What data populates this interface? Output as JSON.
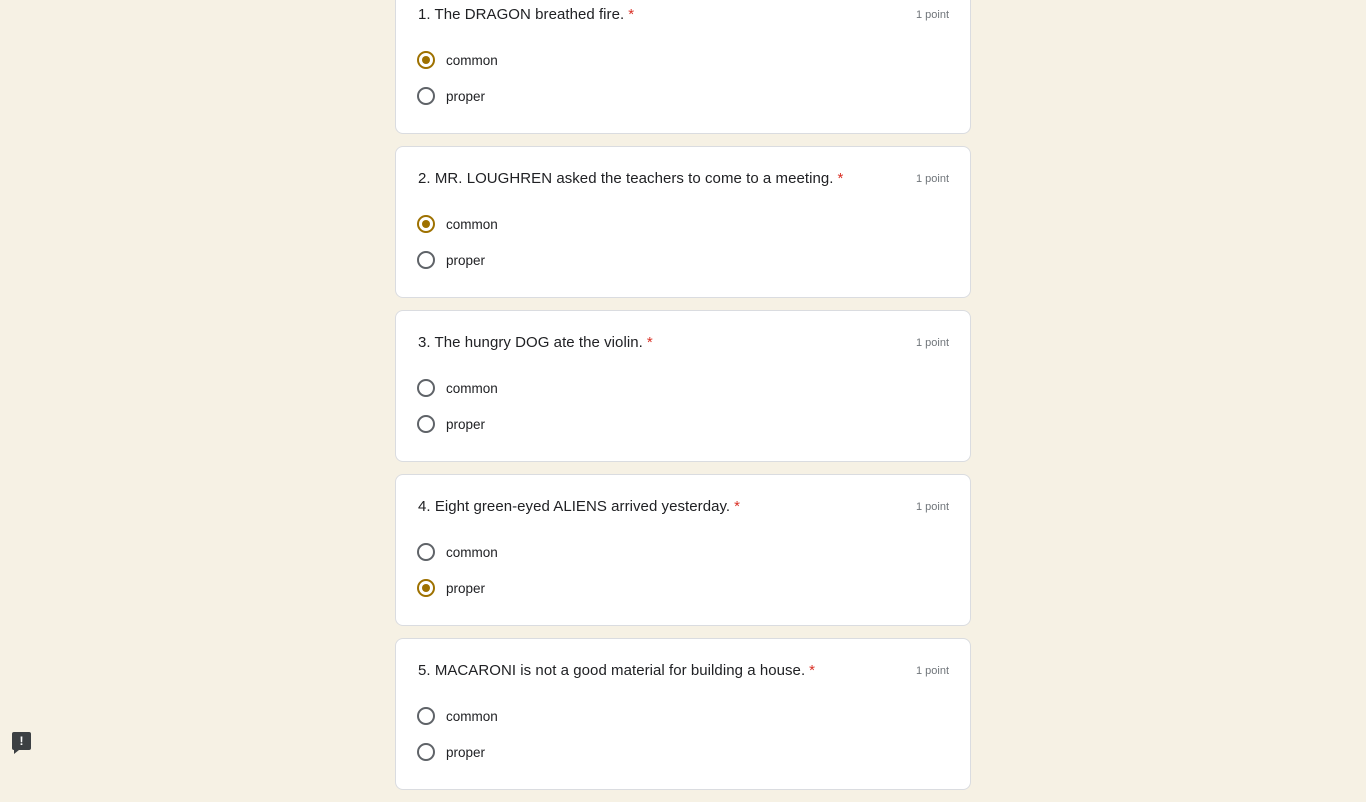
{
  "form": {
    "questions": [
      {
        "title": "1. The DRAGON breathed fire.",
        "required_mark": "*",
        "points": "1 point",
        "options": [
          {
            "label": "common",
            "checked": true
          },
          {
            "label": "proper",
            "checked": false
          }
        ]
      },
      {
        "title": "2. MR. LOUGHREN asked the teachers to come to a meeting.",
        "required_mark": "*",
        "points": "1 point",
        "options": [
          {
            "label": "common",
            "checked": true
          },
          {
            "label": "proper",
            "checked": false
          }
        ]
      },
      {
        "title": "3. The hungry DOG ate the violin.",
        "required_mark": "*",
        "points": "1 point",
        "options": [
          {
            "label": "common",
            "checked": false
          },
          {
            "label": "proper",
            "checked": false
          }
        ]
      },
      {
        "title": "4. Eight green-eyed ALIENS arrived yesterday.",
        "required_mark": "*",
        "points": "1 point",
        "options": [
          {
            "label": "common",
            "checked": false
          },
          {
            "label": "proper",
            "checked": true
          }
        ]
      },
      {
        "title": "5. MACARONI is not a good material for building a house.",
        "required_mark": "*",
        "points": "1 point",
        "options": [
          {
            "label": "common",
            "checked": false
          },
          {
            "label": "proper",
            "checked": false
          }
        ]
      }
    ]
  },
  "feedback": {
    "icon": "report-feedback-icon",
    "glyph": "!"
  },
  "colors": {
    "accent": "#9e7100",
    "background": "#f6f1e4",
    "required": "#d93025"
  }
}
